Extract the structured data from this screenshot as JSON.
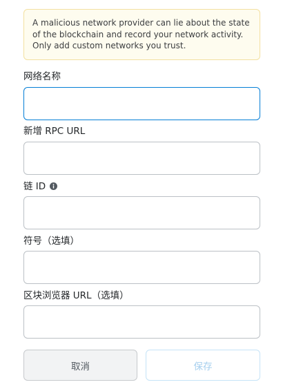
{
  "warning": {
    "text": "A malicious network provider can lie about the state of the blockchain and record your network activity. Only add custom networks you trust."
  },
  "fields": {
    "network_name": {
      "label": "网络名称",
      "value": ""
    },
    "rpc_url": {
      "label": "新增 RPC URL",
      "value": ""
    },
    "chain_id": {
      "label": "链 ID",
      "value": "",
      "info_icon": "info-icon"
    },
    "symbol": {
      "label": "符号（选填）",
      "value": ""
    },
    "explorer_url": {
      "label": "区块浏览器 URL（选填）",
      "value": ""
    }
  },
  "buttons": {
    "cancel": "取消",
    "save": "保存"
  },
  "colors": {
    "focus_border": "#037dd6",
    "warning_bg": "#fefcef",
    "warning_border": "#f3e0a0",
    "save_text_disabled": "#a6cfee"
  }
}
